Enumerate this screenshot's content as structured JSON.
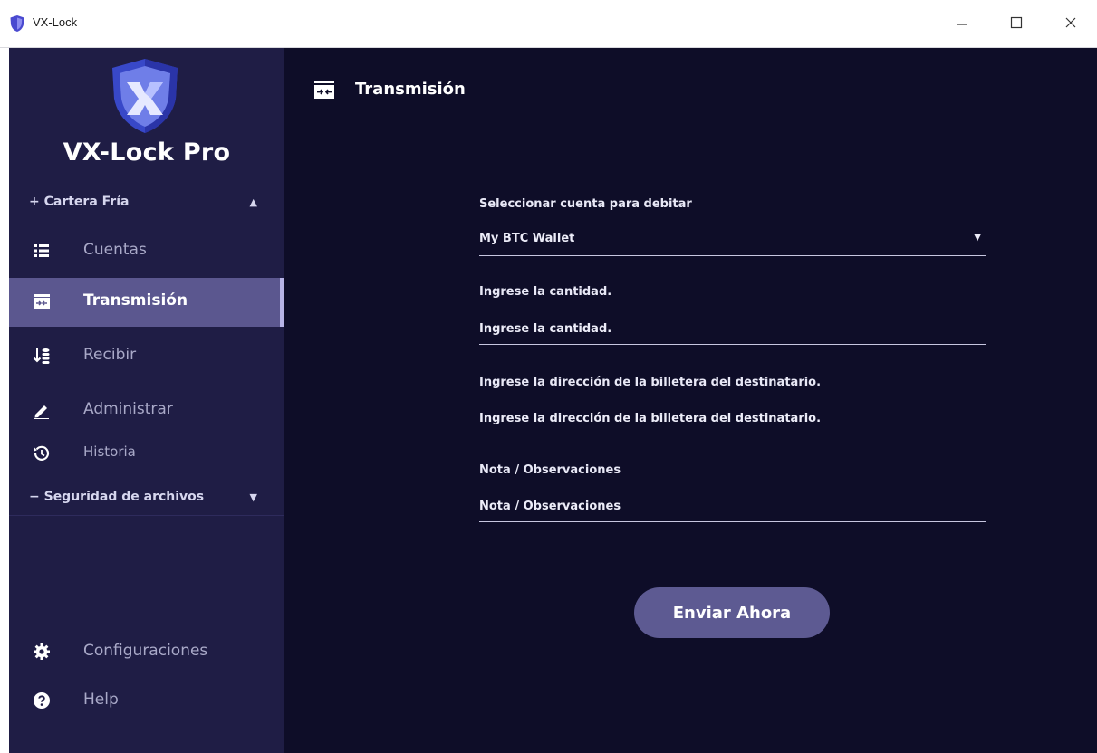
{
  "window": {
    "title": "VX-Lock"
  },
  "sidebar": {
    "brand": "VX-Lock Pro",
    "section_wallet": {
      "label": "+ Cartera Fría",
      "caret": "▲"
    },
    "items": [
      {
        "label": "Cuentas",
        "icon": "list-icon"
      },
      {
        "label": "Transmisión",
        "icon": "transfer-icon",
        "active": true
      },
      {
        "label": "Recibir",
        "icon": "receive-icon"
      },
      {
        "label": "Administrar",
        "icon": "pen-icon"
      },
      {
        "label": "Historia",
        "icon": "history-icon"
      }
    ],
    "section_files": {
      "label": "− Seguridad de archivos",
      "caret": "▼"
    },
    "bottom": [
      {
        "label": "Configuraciones",
        "icon": "gear-icon"
      },
      {
        "label": "Help",
        "icon": "help-icon"
      }
    ]
  },
  "main": {
    "title": "Transmisión",
    "form": {
      "account_label": "Seleccionar cuenta para debitar",
      "account_value": "My BTC Wallet",
      "amount_label": "Ingrese la cantidad.",
      "amount_placeholder": "Ingrese la cantidad.",
      "address_label": "Ingrese la dirección de la billetera del destinatario.",
      "address_placeholder": "Ingrese la dirección de la billetera del destinatario.",
      "note_label": "Nota / Observaciones",
      "note_placeholder": "Nota / Observaciones",
      "send_label": "Enviar Ahora"
    }
  },
  "colors": {
    "sidebar_bg": "#1f1d45",
    "main_bg": "#0e0d28",
    "active_item": "#5b578f",
    "button": "#5d5a92"
  }
}
